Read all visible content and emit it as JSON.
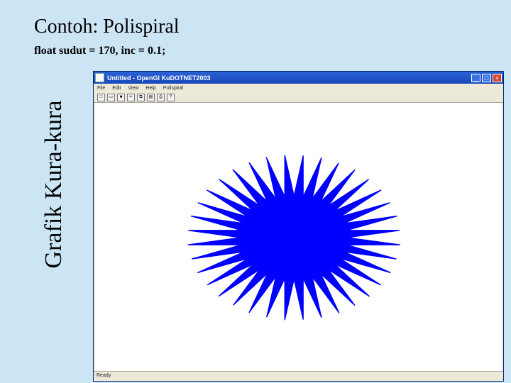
{
  "slide": {
    "title": "Contoh: Polispiral",
    "subtitle": "float sudut = 170, inc = 0.1;",
    "side_title": "Grafik Kura-kura"
  },
  "window": {
    "title": "Untitled - OpenGl KuDOTNET2003",
    "menu": [
      "File",
      "Edit",
      "View",
      "Help",
      "Polispiral"
    ],
    "toolbar_icons": [
      "new-icon",
      "open-icon",
      "save-icon",
      "cut-icon",
      "copy-icon",
      "paste-icon",
      "print-icon",
      "help-icon"
    ],
    "controls": {
      "minimize": "_",
      "maximize": "□",
      "close": "×"
    },
    "status": "Ready"
  },
  "drawing": {
    "stroke_color": "#0000ff",
    "angle_deg": 170,
    "increment": 0.1
  }
}
